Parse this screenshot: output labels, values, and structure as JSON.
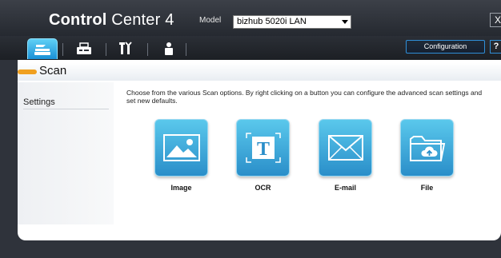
{
  "app": {
    "title_bold": "Control",
    "title_light": "Center 4",
    "close_label": "X"
  },
  "model": {
    "label": "Model",
    "selected": "bizhub 5020i LAN"
  },
  "toolbar": {
    "tabs": [
      {
        "icon": "scanner-icon",
        "active": true
      },
      {
        "icon": "fax-icon",
        "active": false
      },
      {
        "icon": "tools-icon",
        "active": false
      },
      {
        "icon": "person-icon",
        "active": false
      }
    ],
    "configuration_label": "Configuration",
    "help_label": "?"
  },
  "section": {
    "title": "Scan"
  },
  "sidebar": {
    "settings_label": "Settings"
  },
  "description": "Choose from the various Scan options. By right clicking on a button you can configure the advanced scan settings and set new defaults.",
  "scan_buttons": [
    {
      "label": "Image",
      "icon": "image-icon"
    },
    {
      "label": "OCR",
      "icon": "ocr-icon"
    },
    {
      "label": "E-mail",
      "icon": "envelope-icon"
    },
    {
      "label": "File",
      "icon": "folder-icon"
    }
  ],
  "colors": {
    "accent_blue": "#2a8ec9",
    "scan_bar": "#f0a020"
  }
}
